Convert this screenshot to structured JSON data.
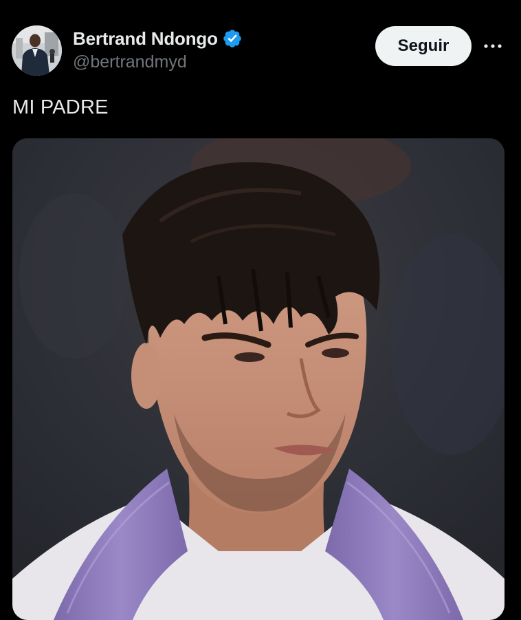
{
  "post": {
    "author": {
      "display_name": "Bertrand Ndongo",
      "handle": "@bertrandmyd",
      "verified": true,
      "verified_color": "#1d9bf0"
    },
    "follow_label": "Seguir",
    "text": "MI PADRE",
    "media": {
      "type": "photo"
    }
  },
  "colors": {
    "background": "#000000",
    "primary_text": "#e7e9ea",
    "secondary_text": "#71767b",
    "follow_button_bg": "#eff3f4",
    "follow_button_text": "#0f1419",
    "accent": "#1d9bf0",
    "kit_lilac": "#8e7bc0"
  },
  "icons": {
    "verified": "verified-badge-icon",
    "more": "more-options-icon"
  }
}
